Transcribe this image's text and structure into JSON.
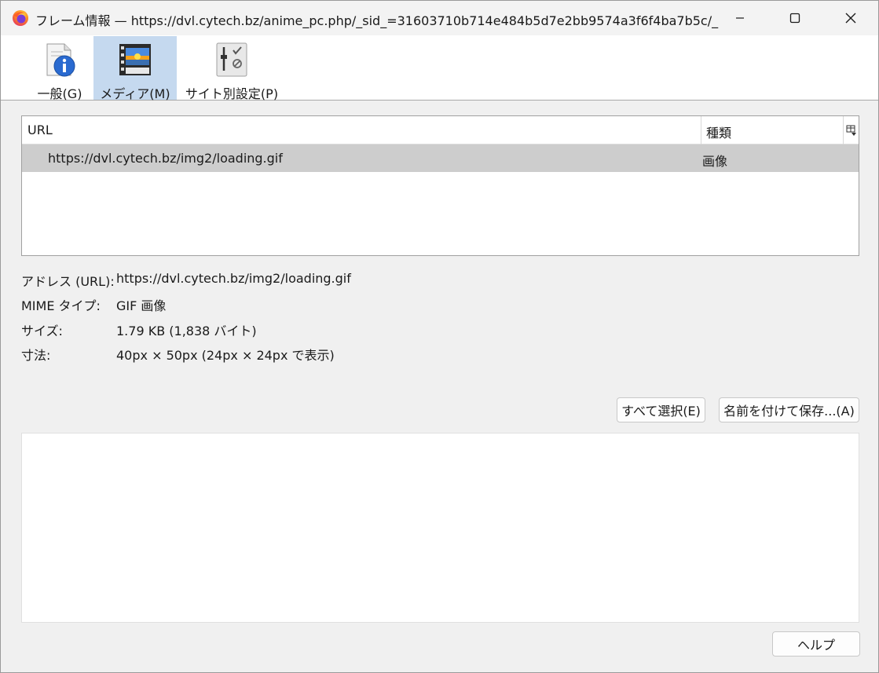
{
  "window": {
    "title": "フレーム情報 — https://dvl.cytech.bz/anime_pc.php/_sid_=31603710b714e484b5d7e2bb9574a3f6f4ba7b5c/_...",
    "app_icon": "firefox-icon"
  },
  "toolbar": {
    "tabs": [
      {
        "label": "一般(G)",
        "icon": "info-icon",
        "selected": false
      },
      {
        "label": "メディア(M)",
        "icon": "media-icon",
        "selected": true
      },
      {
        "label": "サイト別設定(P)",
        "icon": "permissions-icon",
        "selected": false
      }
    ]
  },
  "media_list": {
    "columns": [
      "URL",
      "種類"
    ],
    "rows": [
      {
        "url": "https://dvl.cytech.bz/img2/loading.gif",
        "type": "画像",
        "selected": true
      }
    ]
  },
  "properties": {
    "address_label": "アドレス (URL):",
    "address_value": "https://dvl.cytech.bz/img2/loading.gif",
    "mime_label": "MIME タイプ:",
    "mime_value": "GIF 画像",
    "size_label": "サイズ:",
    "size_value": "1.79 KB (1,838 バイト)",
    "dimensions_label": "寸法:",
    "dimensions_value": "40px × 50px (24px × 24px で表示)"
  },
  "buttons": {
    "select_all": "すべて選択(E)",
    "save_as": "名前を付けて保存...(A)",
    "help": "ヘルプ"
  },
  "colors": {
    "selected_tab": "#c5d9ef",
    "selected_row": "#cdcdcd"
  }
}
